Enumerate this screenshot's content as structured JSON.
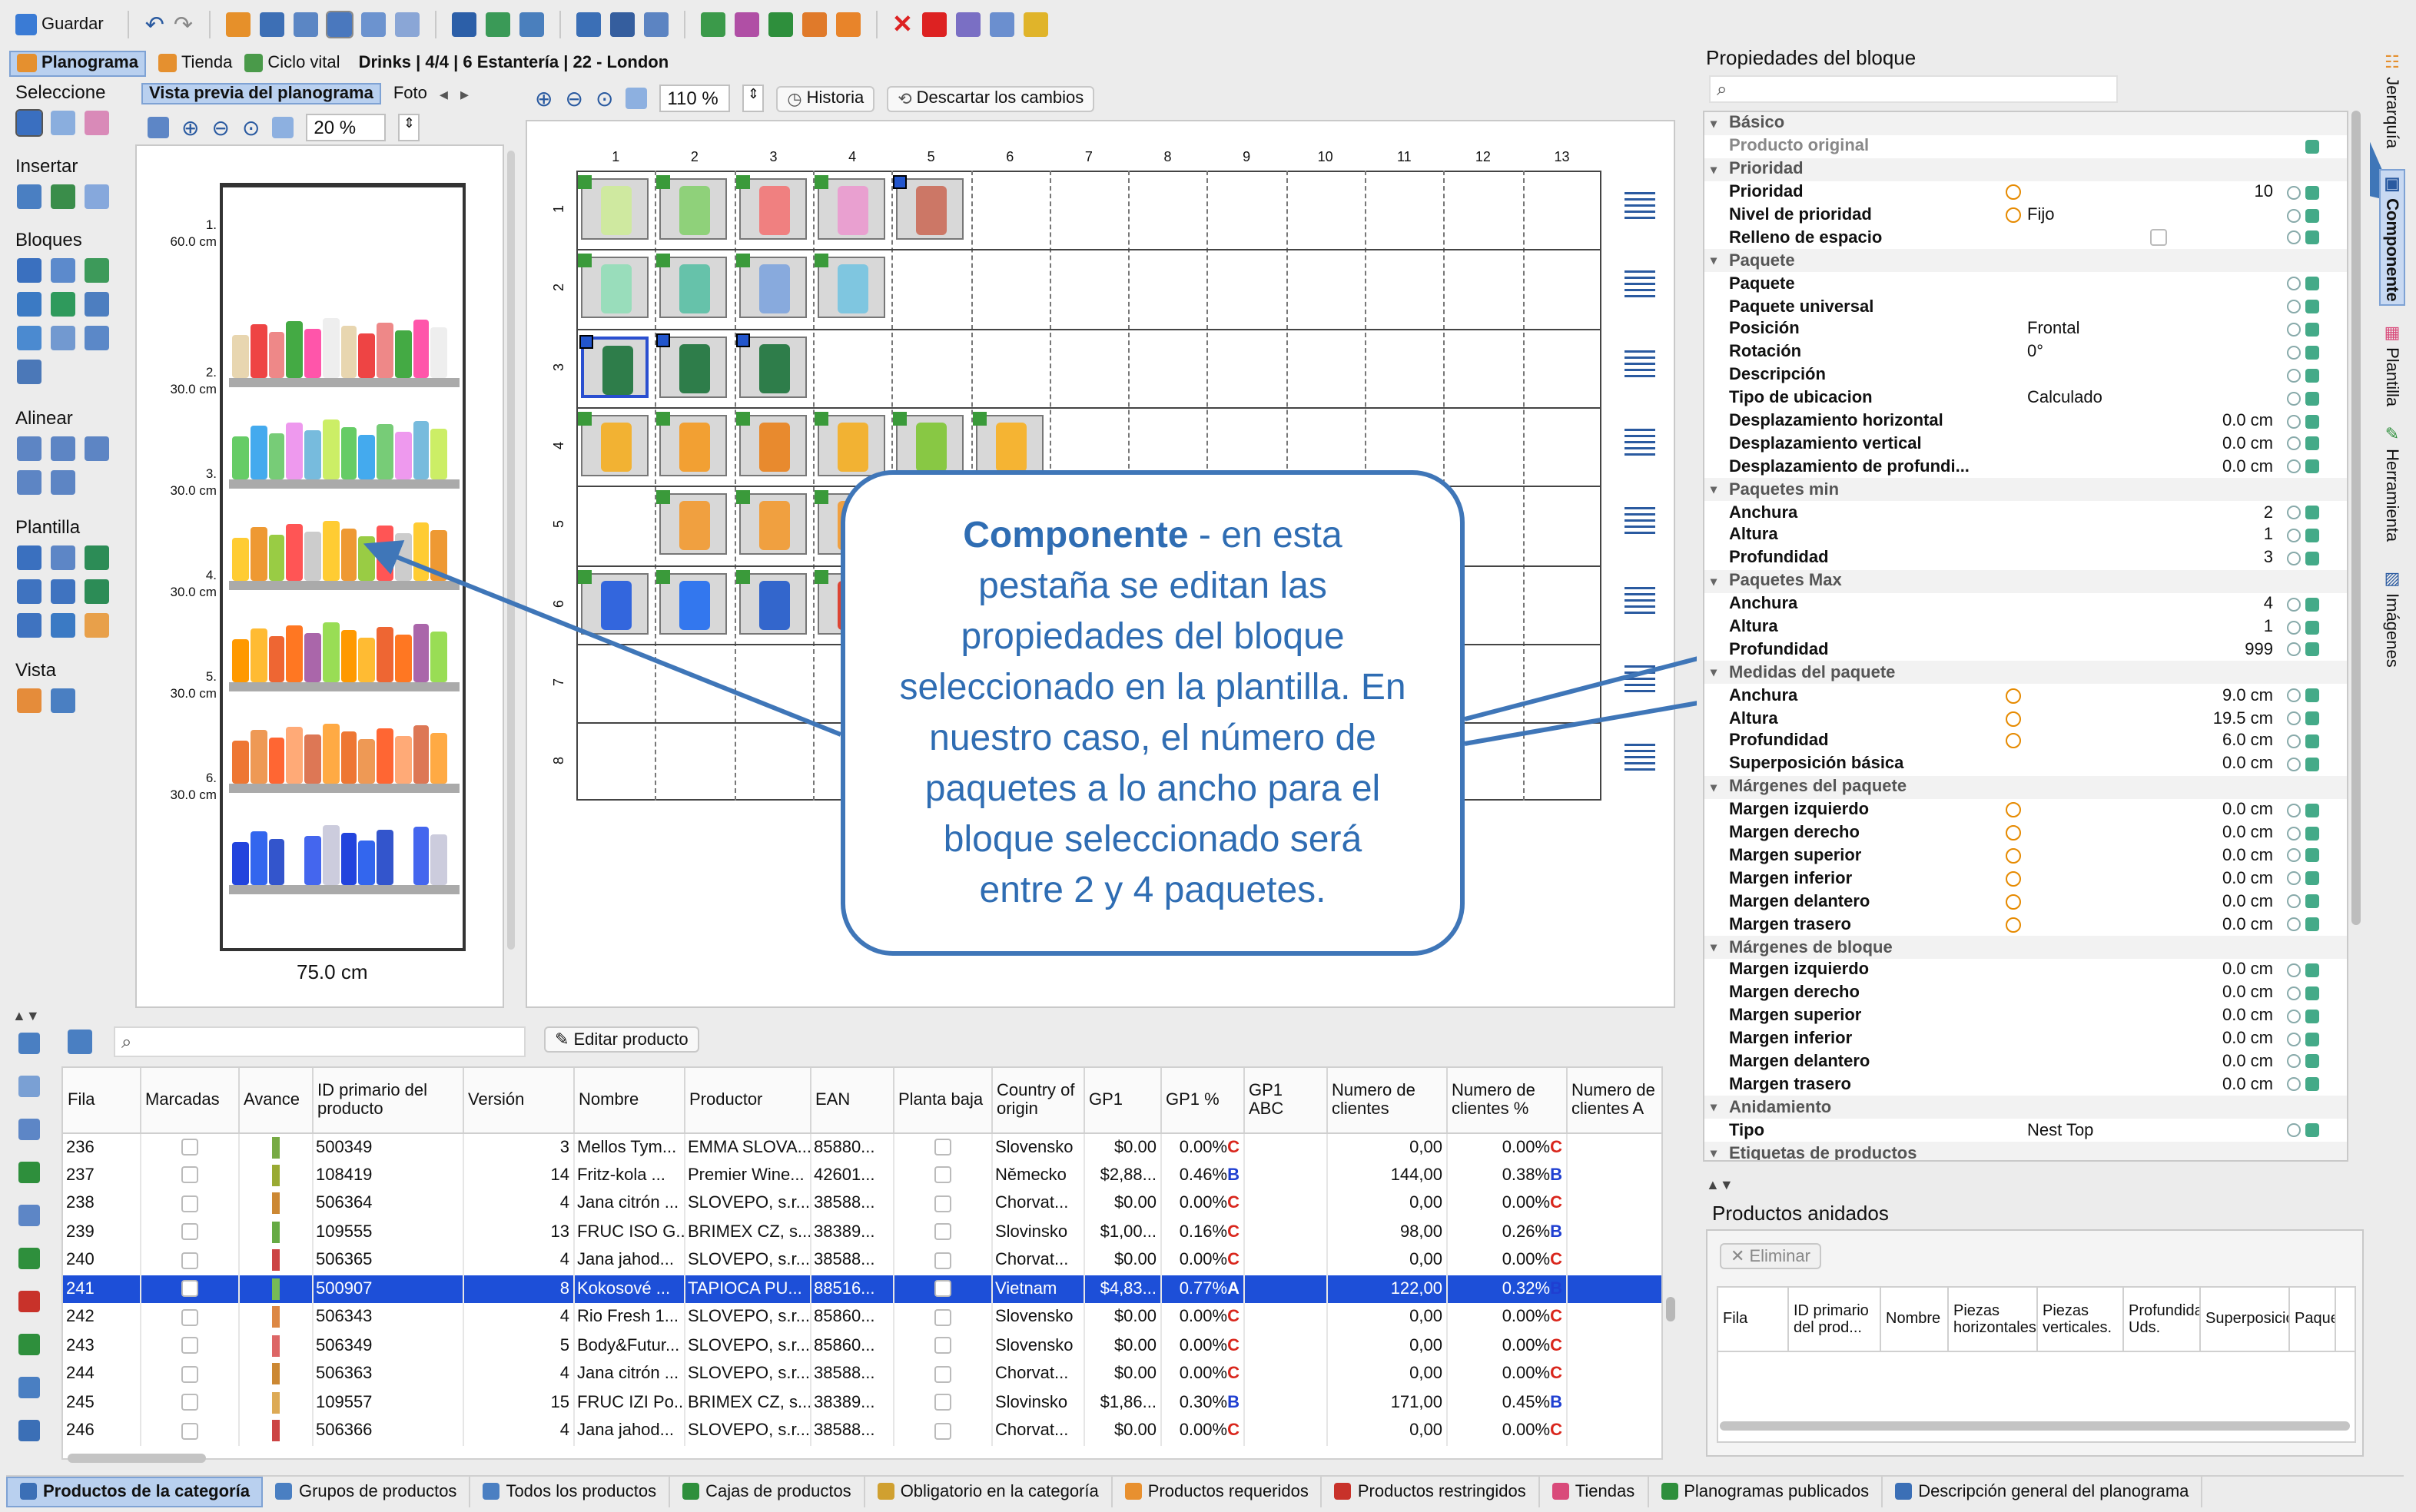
{
  "toolbar": {
    "save": "Guardar"
  },
  "tabs": {
    "planograma": "Planograma",
    "tienda": "Tienda",
    "ciclo": "Ciclo vital",
    "context": "Drinks | 4/4 | 6 Estantería | 22 - London"
  },
  "leftpanel": {
    "seleccione": "Seleccione",
    "insertar": "Insertar",
    "bloques": "Bloques",
    "alinear": "Alinear",
    "plantilla": "Plantilla",
    "vista": "Vista"
  },
  "preview": {
    "tab": "Vista previa del planograma",
    "foto": "Foto",
    "zoom": "20 %",
    "width_label": "75.0 cm",
    "shelves": [
      {
        "n": "1.",
        "h": "60.0 cm"
      },
      {
        "n": "2.",
        "h": "30.0 cm"
      },
      {
        "n": "3.",
        "h": "30.0 cm"
      },
      {
        "n": "4.",
        "h": "30.0 cm"
      },
      {
        "n": "5.",
        "h": "30.0 cm"
      },
      {
        "n": "6.",
        "h": "30.0 cm"
      }
    ]
  },
  "editor": {
    "zoom": "110 %",
    "historia": "Historia",
    "descartar": "Descartar los cambios",
    "cols": [
      "1",
      "2",
      "3",
      "4",
      "5",
      "6",
      "7",
      "8",
      "9",
      "10",
      "11",
      "12",
      "13"
    ],
    "rows": [
      "1",
      "2",
      "3",
      "4",
      "5",
      "6",
      "7",
      "8"
    ]
  },
  "callout": {
    "strong": "Componente",
    "text": " - en esta pestaña se editan las propiedades del bloque seleccionado en la plantilla. En nuestro caso, el número de paquetes a lo ancho para el bloque seleccionado será entre 2 y 4 paquetes."
  },
  "props": {
    "title": "Propiedades del bloque",
    "rows": [
      {
        "n": "Básico",
        "t": "h"
      },
      {
        "n": "Producto original",
        "t": "g"
      },
      {
        "n": "Prioridad",
        "t": "h"
      },
      {
        "n": "Prioridad",
        "v": "10",
        "r": true,
        "i": true
      },
      {
        "n": "Nivel de prioridad",
        "v": "Fijo",
        "i": true
      },
      {
        "n": "Relleno de espacio",
        "chk": true
      },
      {
        "n": "Paquete",
        "t": "h"
      },
      {
        "n": "Paquete"
      },
      {
        "n": "Paquete universal"
      },
      {
        "n": "Posición",
        "v": "Frontal"
      },
      {
        "n": "Rotación",
        "v": "0°"
      },
      {
        "n": "Descripción"
      },
      {
        "n": "Tipo de ubicacion",
        "v": "Calculado"
      },
      {
        "n": "Desplazamiento horizontal",
        "v": "0.0 cm",
        "r": true
      },
      {
        "n": "Desplazamiento vertical",
        "v": "0.0 cm",
        "r": true
      },
      {
        "n": "Desplazamiento de profundi...",
        "v": "0.0 cm",
        "r": true
      },
      {
        "n": "Paquetes min",
        "t": "h"
      },
      {
        "n": "Anchura",
        "v": "2",
        "r": true
      },
      {
        "n": "Altura",
        "v": "1",
        "r": true
      },
      {
        "n": "Profundidad",
        "v": "3",
        "r": true
      },
      {
        "n": "Paquetes Max",
        "t": "h"
      },
      {
        "n": "Anchura",
        "v": "4",
        "r": true
      },
      {
        "n": "Altura",
        "v": "1",
        "r": true
      },
      {
        "n": "Profundidad",
        "v": "999",
        "r": true
      },
      {
        "n": "Medidas del paquete",
        "t": "h"
      },
      {
        "n": "Anchura",
        "v": "9.0 cm",
        "r": true,
        "i": true
      },
      {
        "n": "Altura",
        "v": "19.5 cm",
        "r": true,
        "i": true
      },
      {
        "n": "Profundidad",
        "v": "6.0 cm",
        "r": true,
        "i": true
      },
      {
        "n": "Superposición básica",
        "v": "0.0 cm",
        "r": true
      },
      {
        "n": "Márgenes del paquete",
        "t": "h"
      },
      {
        "n": "Margen izquierdo",
        "v": "0.0 cm",
        "r": true,
        "i": true
      },
      {
        "n": "Margen derecho",
        "v": "0.0 cm",
        "r": true,
        "i": true
      },
      {
        "n": "Margen superior",
        "v": "0.0 cm",
        "r": true,
        "i": true
      },
      {
        "n": "Margen inferior",
        "v": "0.0 cm",
        "r": true,
        "i": true
      },
      {
        "n": "Margen delantero",
        "v": "0.0 cm",
        "r": true,
        "i": true
      },
      {
        "n": "Margen trasero",
        "v": "0.0 cm",
        "r": true,
        "i": true
      },
      {
        "n": "Márgenes de bloque",
        "t": "h"
      },
      {
        "n": "Margen izquierdo",
        "v": "0.0 cm",
        "r": true
      },
      {
        "n": "Margen derecho",
        "v": "0.0 cm",
        "r": true
      },
      {
        "n": "Margen superior",
        "v": "0.0 cm",
        "r": true
      },
      {
        "n": "Margen inferior",
        "v": "0.0 cm",
        "r": true
      },
      {
        "n": "Margen delantero",
        "v": "0.0 cm",
        "r": true
      },
      {
        "n": "Margen trasero",
        "v": "0.0 cm",
        "r": true
      },
      {
        "n": "Anidamiento",
        "t": "h"
      },
      {
        "n": "Tipo",
        "v": "Nest Top"
      },
      {
        "n": "Etiquetas de productos",
        "t": "h"
      }
    ]
  },
  "sidetabs": [
    "Jerarquía",
    "Componente",
    "Plantilla",
    "Herramienta",
    "Imágenes"
  ],
  "nested": {
    "title": "Productos anidados",
    "eliminar": "Eliminar",
    "headers": [
      "Fila",
      "ID primario del prod...",
      "Nombre",
      "Piezas horizontales.",
      "Piezas verticales.",
      "Profundidad Uds.",
      "Superposición",
      "Paquete"
    ]
  },
  "products": {
    "edit": "Editar producto",
    "headers": [
      "Fila",
      "Marcadas",
      "Avance",
      "ID primario del producto",
      "Versión",
      "Nombre",
      "Productor",
      "EAN",
      "Planta baja",
      "Country of origin",
      "GP1",
      "GP1 %",
      "GP1 ABC",
      "Numero de clientes",
      "Numero de clientes %",
      "Numero de clientes A"
    ],
    "rows": [
      [
        "236",
        "500349",
        "3",
        "Mellos Tym...",
        "EMMA SLOVA...",
        "85880...",
        "Slovensko",
        "$0.00",
        "0.00%",
        "C",
        "0,00",
        "0.00%",
        "C"
      ],
      [
        "237",
        "108419",
        "14",
        "Fritz-kola ...",
        "Premier Wine...",
        "42601...",
        "Německo",
        "$2,88...",
        "0.46%",
        "B",
        "144,00",
        "0.38%",
        "B"
      ],
      [
        "238",
        "506364",
        "4",
        "Jana citrón ...",
        "SLOVEPO, s.r...",
        "38588...",
        "Chorvat...",
        "$0.00",
        "0.00%",
        "C",
        "0,00",
        "0.00%",
        "C"
      ],
      [
        "239",
        "109555",
        "13",
        "FRUC ISO G...",
        "BRIMEX CZ, s...",
        "38389...",
        "Slovinsko",
        "$1,00...",
        "0.16%",
        "C",
        "98,00",
        "0.26%",
        "B"
      ],
      [
        "240",
        "506365",
        "4",
        "Jana jahod...",
        "SLOVEPO, s.r...",
        "38588...",
        "Chorvat...",
        "$0.00",
        "0.00%",
        "C",
        "0,00",
        "0.00%",
        "C"
      ],
      [
        "241",
        "500907",
        "8",
        "Kokosové ...",
        "TAPIOCA PU...",
        "88516...",
        "Vietnam",
        "$4,83...",
        "0.77%",
        "A",
        "122,00",
        "0.32%",
        "B"
      ],
      [
        "242",
        "506343",
        "4",
        "Rio Fresh 1...",
        "SLOVEPO, s.r...",
        "85860...",
        "Slovensko",
        "$0.00",
        "0.00%",
        "C",
        "0,00",
        "0.00%",
        "C"
      ],
      [
        "243",
        "506349",
        "5",
        "Body&Futur...",
        "SLOVEPO, s.r...",
        "85860...",
        "Slovensko",
        "$0.00",
        "0.00%",
        "C",
        "0,00",
        "0.00%",
        "C"
      ],
      [
        "244",
        "506363",
        "4",
        "Jana citrón ...",
        "SLOVEPO, s.r...",
        "38588...",
        "Chorvat...",
        "$0.00",
        "0.00%",
        "C",
        "0,00",
        "0.00%",
        "C"
      ],
      [
        "245",
        "109557",
        "15",
        "FRUC IZI Po...",
        "BRIMEX CZ, s...",
        "38389...",
        "Slovinsko",
        "$1,86...",
        "0.30%",
        "B",
        "171,00",
        "0.45%",
        "B"
      ],
      [
        "246",
        "506366",
        "4",
        "Jana jahod...",
        "SLOVEPO, s.r...",
        "38588...",
        "Chorvat...",
        "$0.00",
        "0.00%",
        "C",
        "0,00",
        "0.00%",
        "C"
      ]
    ]
  },
  "bottomtabs": [
    "Productos de la categoría",
    "Grupos de productos",
    "Todos los productos",
    "Cajas de productos",
    "Obligatorio en la categoría",
    "Productos requeridos",
    "Productos restringidos",
    "Tiendas",
    "Planogramas publicados",
    "Descripción general del planograma"
  ],
  "colors": {
    "accent": "#2f6db3",
    "selection": "#1d4fd8",
    "callout_border": "#3f76b8",
    "callout_text": "#2f6db3",
    "abc_red": "#d9261c",
    "abc_blue": "#1f3fd1"
  }
}
